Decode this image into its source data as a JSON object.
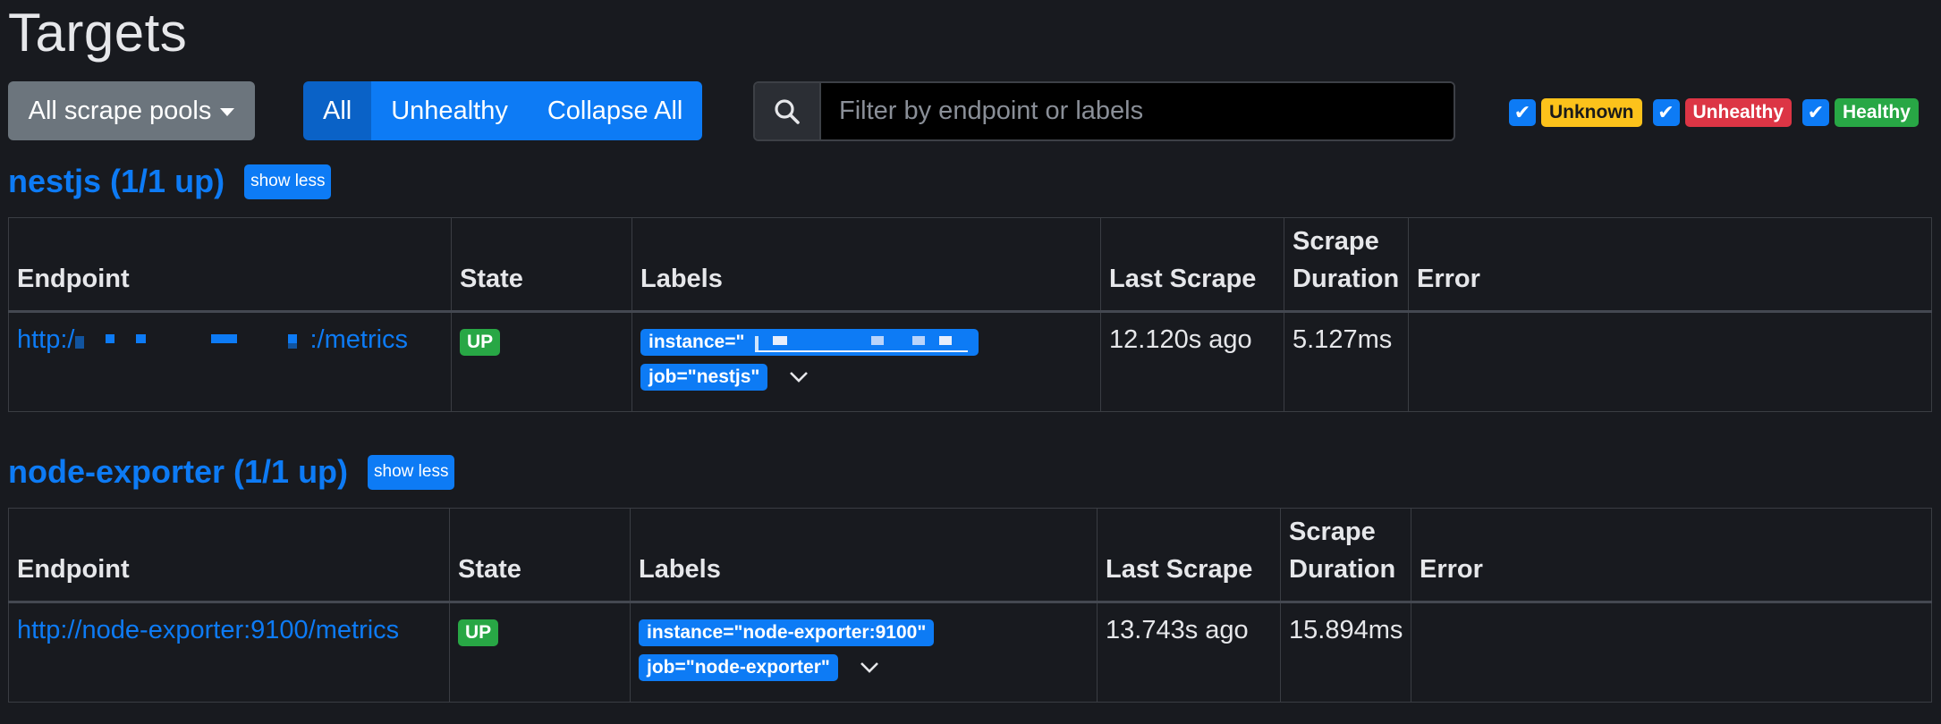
{
  "page": {
    "title": "Targets"
  },
  "toolbar": {
    "scrape_pools_label": "All scrape pools",
    "buttons": [
      {
        "label": "All",
        "active": true
      },
      {
        "label": "Unhealthy",
        "active": false
      },
      {
        "label": "Collapse All",
        "active": false
      }
    ],
    "search_placeholder": "Filter by endpoint or labels",
    "filters": [
      {
        "label": "Unknown",
        "checked": true,
        "color": "#fcc21b"
      },
      {
        "label": "Unhealthy",
        "checked": true,
        "color": "#dc3545"
      },
      {
        "label": "Healthy",
        "checked": true,
        "color": "#28a745"
      }
    ]
  },
  "table_headers": {
    "endpoint": "Endpoint",
    "state": "State",
    "labels": "Labels",
    "last_scrape": "Last Scrape",
    "scrape_duration_line1": "Scrape",
    "scrape_duration_line2": "Duration",
    "error": "Error"
  },
  "pools": [
    {
      "title": "nestjs (1/1 up)",
      "show_less_label": "show less",
      "targets": [
        {
          "endpoint_prefix": "http:/",
          "endpoint_suffix": ":/metrics",
          "state": "UP",
          "label_instance": "instance=\"",
          "label_job": "job=\"nestjs\"",
          "last_scrape": "12.120s ago",
          "scrape_duration": "5.127ms",
          "error": ""
        }
      ]
    },
    {
      "title": "node-exporter (1/1 up)",
      "show_less_label": "show less",
      "targets": [
        {
          "endpoint": "http://node-exporter:9100/metrics",
          "state": "UP",
          "label_instance": "instance=\"node-exporter:9100\"",
          "label_job": "job=\"node-exporter\"",
          "last_scrape": "13.743s ago",
          "scrape_duration": "15.894ms",
          "error": ""
        }
      ]
    }
  ],
  "colors": {
    "background": "#181a1f",
    "primary": "#0d7bf5",
    "success": "#28a745",
    "danger": "#dc3545",
    "warning": "#fcc21b",
    "secondary": "#6c757d"
  },
  "icons": [
    "caret-down-icon",
    "search-icon",
    "check-icon",
    "chevron-down-icon"
  ]
}
